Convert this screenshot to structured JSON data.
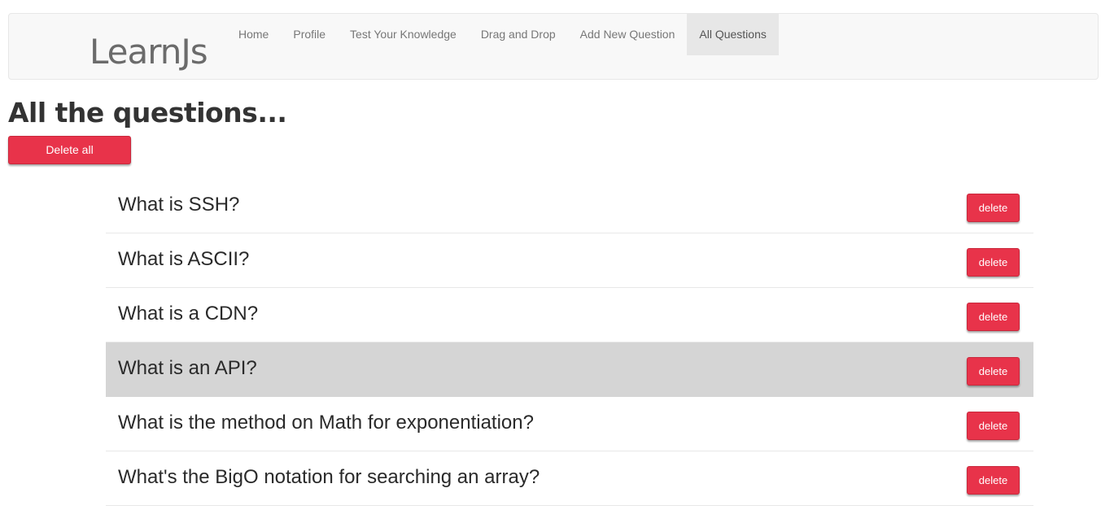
{
  "navbar": {
    "brand": "LearnJs",
    "links": [
      {
        "label": "Home",
        "active": false
      },
      {
        "label": "Profile",
        "active": false
      },
      {
        "label": "Test Your Knowledge",
        "active": false
      },
      {
        "label": "Drag and Drop",
        "active": false
      },
      {
        "label": "Add New Question",
        "active": false
      },
      {
        "label": "All Questions",
        "active": true
      }
    ]
  },
  "page": {
    "title": "All the questions...",
    "delete_all_label": "Delete all"
  },
  "questions": [
    {
      "text": "What is SSH?",
      "delete_label": "delete",
      "highlighted": false
    },
    {
      "text": "What is ASCII?",
      "delete_label": "delete",
      "highlighted": false
    },
    {
      "text": "What is a CDN?",
      "delete_label": "delete",
      "highlighted": false
    },
    {
      "text": "What is an API?",
      "delete_label": "delete",
      "highlighted": true
    },
    {
      "text": "What is the method on Math for exponentiation?",
      "delete_label": "delete",
      "highlighted": false
    },
    {
      "text": "What's the BigO notation for searching an array?",
      "delete_label": "delete",
      "highlighted": false
    }
  ],
  "colors": {
    "danger": "#e8334a",
    "navbar_bg": "#f8f8f8",
    "active_nav_bg": "#e7e7e7",
    "row_highlight": "#d5d5d5"
  }
}
